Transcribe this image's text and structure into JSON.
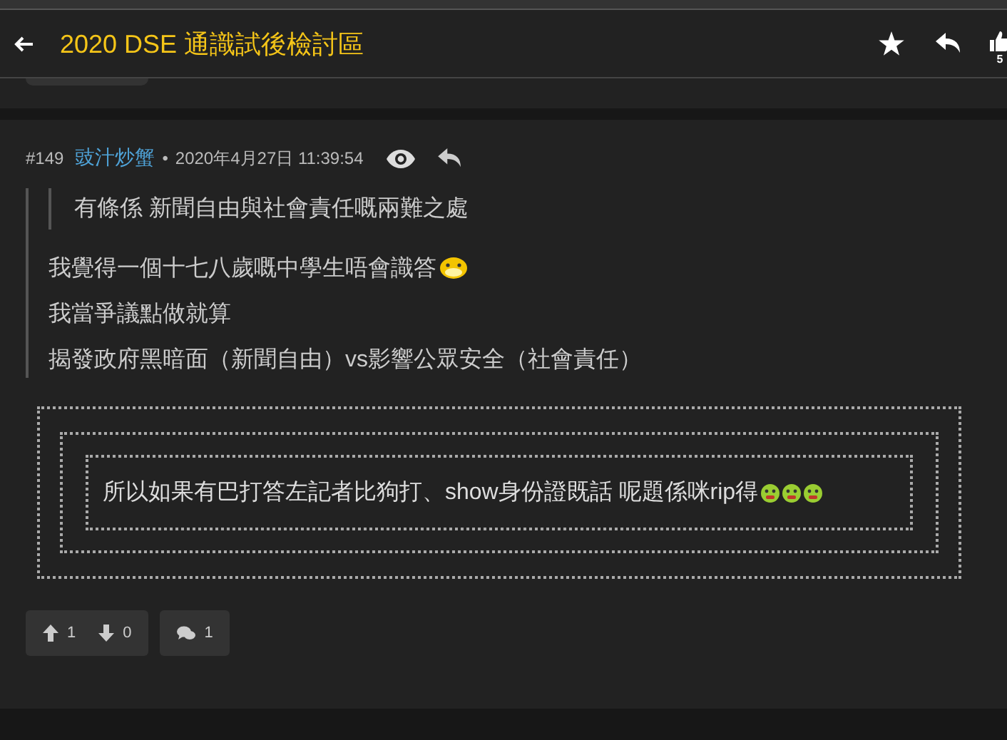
{
  "header": {
    "title": "2020 DSE 通識試後檢討區",
    "like_count": "5"
  },
  "post": {
    "number": "#149",
    "author": "豉汁炒蟹",
    "separator": "•",
    "time": "2020年4月27日 11:39:54",
    "quote": "有條係 新聞自由與社會責任嘅兩難之處",
    "lines": [
      "我覺得一個十七八歲嘅中學生唔會識答",
      "我當爭議點做就算",
      "揭發政府黑暗面（新聞自由）vs影響公眾安全（社會責任）"
    ],
    "nested_quote": "所以如果有巴打答左記者比狗打、show身份證既話 呢題係咪rip得",
    "upvotes": "1",
    "downvotes": "0",
    "replies": "1"
  }
}
